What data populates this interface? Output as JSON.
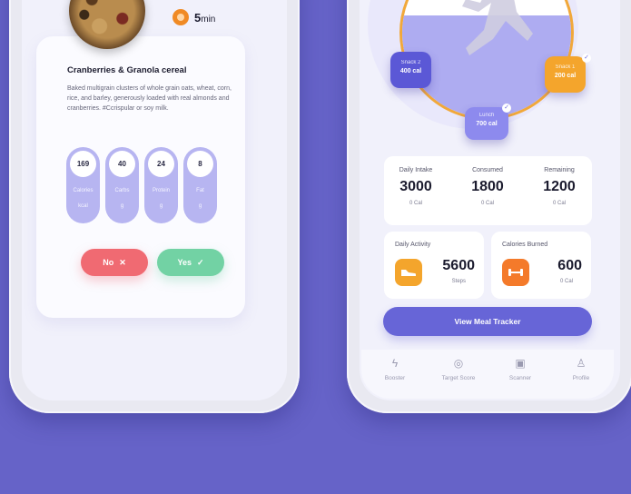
{
  "left_phone": {
    "timer": {
      "value": "5",
      "unit": "min"
    },
    "food": {
      "title": "Cranberries & Granola cereal",
      "description": "Baked multigrain clusters of whole grain oats, wheat, corn, rice, and barley, generously loaded with real almonds and cranberries. #Ccrispular or soy milk."
    },
    "macros": [
      {
        "value": "169",
        "label": "Calories",
        "sub": "kcal"
      },
      {
        "value": "40",
        "label": "Carbs",
        "sub": "g"
      },
      {
        "value": "24",
        "label": "Protein",
        "sub": "g"
      },
      {
        "value": "8",
        "label": "Fat",
        "sub": "g"
      }
    ],
    "buttons": {
      "no": "No",
      "yes": "Yes"
    }
  },
  "right_phone": {
    "badges": {
      "snack2": {
        "title": "Snack 2",
        "value": "400 cal"
      },
      "snack1": {
        "title": "Snack 1",
        "value": "200 cal"
      },
      "lunch": {
        "title": "Lunch",
        "value": "700 cal"
      }
    },
    "stats": [
      {
        "label": "Daily Intake",
        "value": "3000",
        "unit": "0 Cal"
      },
      {
        "label": "Consumed",
        "value": "1800",
        "unit": "0 Cal"
      },
      {
        "label": "Remaining",
        "value": "1200",
        "unit": "0 Cal"
      }
    ],
    "activity": {
      "label": "Daily Activity",
      "value": "5600",
      "unit": "Steps"
    },
    "burned": {
      "label": "Calories Burned",
      "value": "600",
      "unit": "0 Cal"
    },
    "meal_button": "View Meal Tracker",
    "tabs": [
      {
        "label": "Booster",
        "icon": "bolt-icon"
      },
      {
        "label": "Target Score",
        "icon": "target-icon"
      },
      {
        "label": "Scanner",
        "icon": "scanner-icon"
      },
      {
        "label": "Profile",
        "icon": "profile-icon"
      }
    ]
  },
  "colors": {
    "background": "#6663c8",
    "accent": "#6765d7",
    "orange": "#f4a52c",
    "red": "#f06a72",
    "green": "#72d2a4"
  }
}
